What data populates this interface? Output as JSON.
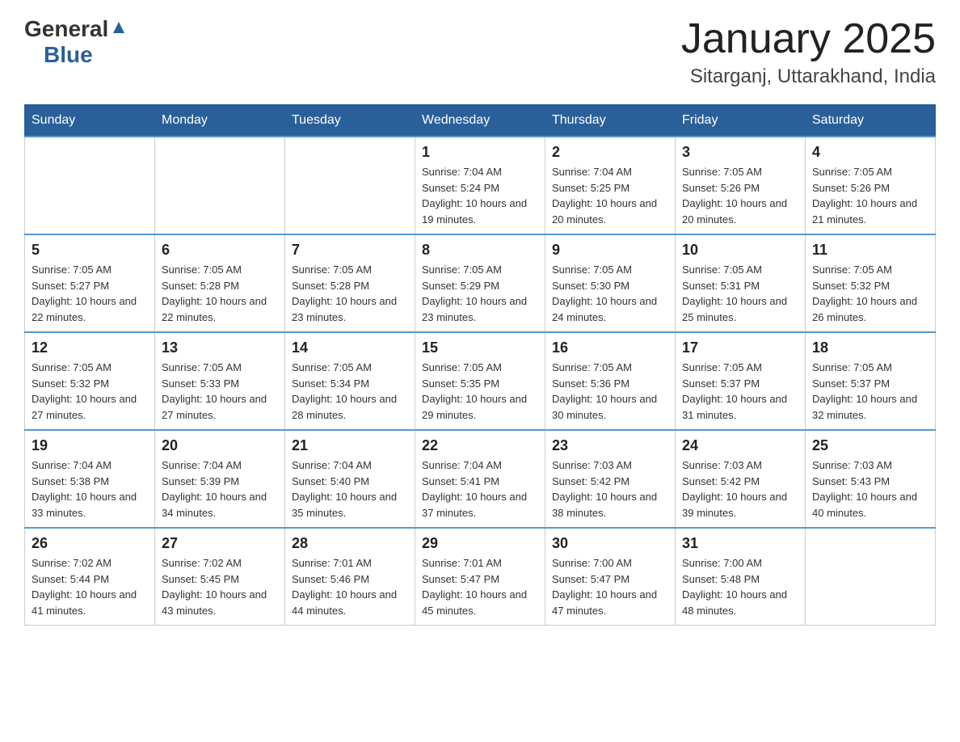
{
  "header": {
    "logo_general": "General",
    "logo_blue": "Blue",
    "title": "January 2025",
    "subtitle": "Sitarganj, Uttarakhand, India"
  },
  "calendar": {
    "days_of_week": [
      "Sunday",
      "Monday",
      "Tuesday",
      "Wednesday",
      "Thursday",
      "Friday",
      "Saturday"
    ],
    "weeks": [
      [
        {
          "day": "",
          "info": ""
        },
        {
          "day": "",
          "info": ""
        },
        {
          "day": "",
          "info": ""
        },
        {
          "day": "1",
          "info": "Sunrise: 7:04 AM\nSunset: 5:24 PM\nDaylight: 10 hours and 19 minutes."
        },
        {
          "day": "2",
          "info": "Sunrise: 7:04 AM\nSunset: 5:25 PM\nDaylight: 10 hours and 20 minutes."
        },
        {
          "day": "3",
          "info": "Sunrise: 7:05 AM\nSunset: 5:26 PM\nDaylight: 10 hours and 20 minutes."
        },
        {
          "day": "4",
          "info": "Sunrise: 7:05 AM\nSunset: 5:26 PM\nDaylight: 10 hours and 21 minutes."
        }
      ],
      [
        {
          "day": "5",
          "info": "Sunrise: 7:05 AM\nSunset: 5:27 PM\nDaylight: 10 hours and 22 minutes."
        },
        {
          "day": "6",
          "info": "Sunrise: 7:05 AM\nSunset: 5:28 PM\nDaylight: 10 hours and 22 minutes."
        },
        {
          "day": "7",
          "info": "Sunrise: 7:05 AM\nSunset: 5:28 PM\nDaylight: 10 hours and 23 minutes."
        },
        {
          "day": "8",
          "info": "Sunrise: 7:05 AM\nSunset: 5:29 PM\nDaylight: 10 hours and 23 minutes."
        },
        {
          "day": "9",
          "info": "Sunrise: 7:05 AM\nSunset: 5:30 PM\nDaylight: 10 hours and 24 minutes."
        },
        {
          "day": "10",
          "info": "Sunrise: 7:05 AM\nSunset: 5:31 PM\nDaylight: 10 hours and 25 minutes."
        },
        {
          "day": "11",
          "info": "Sunrise: 7:05 AM\nSunset: 5:32 PM\nDaylight: 10 hours and 26 minutes."
        }
      ],
      [
        {
          "day": "12",
          "info": "Sunrise: 7:05 AM\nSunset: 5:32 PM\nDaylight: 10 hours and 27 minutes."
        },
        {
          "day": "13",
          "info": "Sunrise: 7:05 AM\nSunset: 5:33 PM\nDaylight: 10 hours and 27 minutes."
        },
        {
          "day": "14",
          "info": "Sunrise: 7:05 AM\nSunset: 5:34 PM\nDaylight: 10 hours and 28 minutes."
        },
        {
          "day": "15",
          "info": "Sunrise: 7:05 AM\nSunset: 5:35 PM\nDaylight: 10 hours and 29 minutes."
        },
        {
          "day": "16",
          "info": "Sunrise: 7:05 AM\nSunset: 5:36 PM\nDaylight: 10 hours and 30 minutes."
        },
        {
          "day": "17",
          "info": "Sunrise: 7:05 AM\nSunset: 5:37 PM\nDaylight: 10 hours and 31 minutes."
        },
        {
          "day": "18",
          "info": "Sunrise: 7:05 AM\nSunset: 5:37 PM\nDaylight: 10 hours and 32 minutes."
        }
      ],
      [
        {
          "day": "19",
          "info": "Sunrise: 7:04 AM\nSunset: 5:38 PM\nDaylight: 10 hours and 33 minutes."
        },
        {
          "day": "20",
          "info": "Sunrise: 7:04 AM\nSunset: 5:39 PM\nDaylight: 10 hours and 34 minutes."
        },
        {
          "day": "21",
          "info": "Sunrise: 7:04 AM\nSunset: 5:40 PM\nDaylight: 10 hours and 35 minutes."
        },
        {
          "day": "22",
          "info": "Sunrise: 7:04 AM\nSunset: 5:41 PM\nDaylight: 10 hours and 37 minutes."
        },
        {
          "day": "23",
          "info": "Sunrise: 7:03 AM\nSunset: 5:42 PM\nDaylight: 10 hours and 38 minutes."
        },
        {
          "day": "24",
          "info": "Sunrise: 7:03 AM\nSunset: 5:42 PM\nDaylight: 10 hours and 39 minutes."
        },
        {
          "day": "25",
          "info": "Sunrise: 7:03 AM\nSunset: 5:43 PM\nDaylight: 10 hours and 40 minutes."
        }
      ],
      [
        {
          "day": "26",
          "info": "Sunrise: 7:02 AM\nSunset: 5:44 PM\nDaylight: 10 hours and 41 minutes."
        },
        {
          "day": "27",
          "info": "Sunrise: 7:02 AM\nSunset: 5:45 PM\nDaylight: 10 hours and 43 minutes."
        },
        {
          "day": "28",
          "info": "Sunrise: 7:01 AM\nSunset: 5:46 PM\nDaylight: 10 hours and 44 minutes."
        },
        {
          "day": "29",
          "info": "Sunrise: 7:01 AM\nSunset: 5:47 PM\nDaylight: 10 hours and 45 minutes."
        },
        {
          "day": "30",
          "info": "Sunrise: 7:00 AM\nSunset: 5:47 PM\nDaylight: 10 hours and 47 minutes."
        },
        {
          "day": "31",
          "info": "Sunrise: 7:00 AM\nSunset: 5:48 PM\nDaylight: 10 hours and 48 minutes."
        },
        {
          "day": "",
          "info": ""
        }
      ]
    ]
  }
}
